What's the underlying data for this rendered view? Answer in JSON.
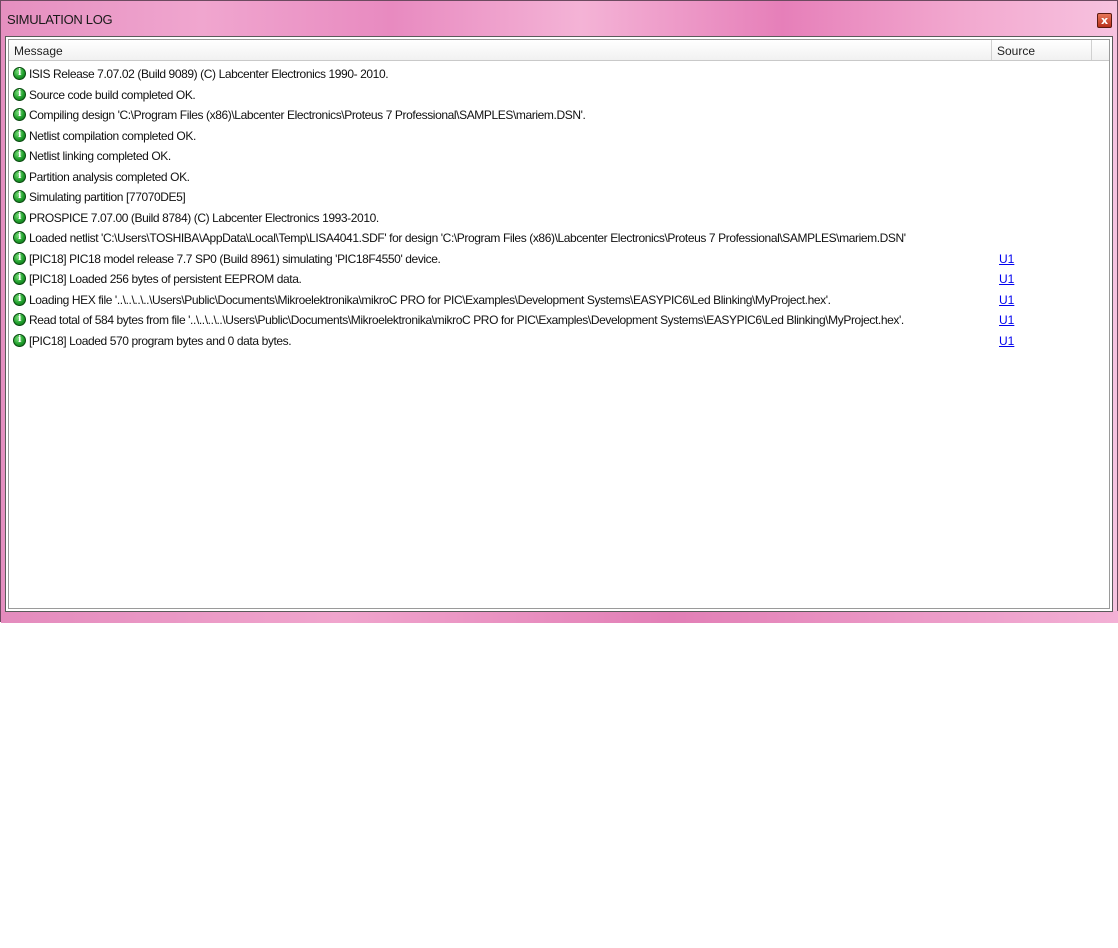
{
  "window": {
    "title": "SIMULATION LOG",
    "close_glyph": "x"
  },
  "columns": {
    "message": "Message",
    "source": "Source"
  },
  "info_icon_glyph": "i",
  "rows": [
    {
      "message": "ISIS Release 7.07.02 (Build 9089) (C) Labcenter Electronics 1990- 2010.",
      "source": ""
    },
    {
      "message": "Source code build completed OK.",
      "source": ""
    },
    {
      "message": "Compiling design 'C:\\Program Files (x86)\\Labcenter Electronics\\Proteus 7 Professional\\SAMPLES\\mariem.DSN'.",
      "source": ""
    },
    {
      "message": "Netlist compilation completed OK.",
      "source": ""
    },
    {
      "message": "Netlist linking completed OK.",
      "source": ""
    },
    {
      "message": "Partition analysis completed OK.",
      "source": ""
    },
    {
      "message": "Simulating partition [77070DE5]",
      "source": ""
    },
    {
      "message": "PROSPICE 7.07.00 (Build 8784) (C) Labcenter Electronics 1993-2010.",
      "source": ""
    },
    {
      "message": "Loaded netlist 'C:\\Users\\TOSHIBA\\AppData\\Local\\Temp\\LISA4041.SDF' for design 'C:\\Program Files (x86)\\Labcenter Electronics\\Proteus 7 Professional\\SAMPLES\\mariem.DSN'",
      "source": ""
    },
    {
      "message": "[PIC18] PIC18 model release 7.7 SP0 (Build 8961) simulating 'PIC18F4550' device.",
      "source": "U1"
    },
    {
      "message": "[PIC18] Loaded 256 bytes of persistent EEPROM data.",
      "source": "U1"
    },
    {
      "message": "Loading HEX file '..\\..\\..\\..\\Users\\Public\\Documents\\Mikroelektronika\\mikroC PRO for PIC\\Examples\\Development Systems\\EASYPIC6\\Led Blinking\\MyProject.hex'.",
      "source": "U1"
    },
    {
      "message": "Read total of 584 bytes from file '..\\..\\..\\..\\Users\\Public\\Documents\\Mikroelektronika\\mikroC PRO for PIC\\Examples\\Development Systems\\EASYPIC6\\Led Blinking\\MyProject.hex'.",
      "source": "U1"
    },
    {
      "message": "[PIC18] Loaded 570 program bytes and 0 data bytes.",
      "source": "U1"
    }
  ]
}
